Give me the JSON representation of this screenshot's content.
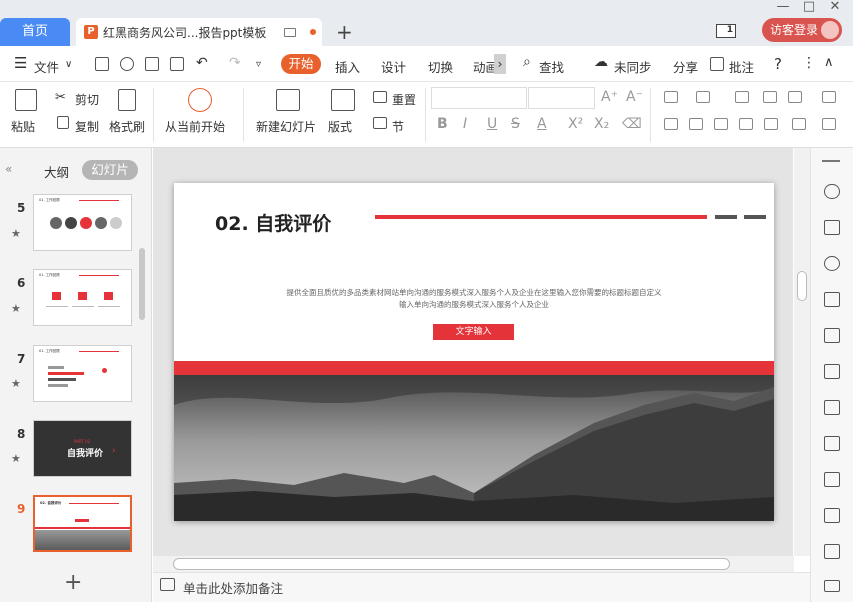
{
  "titlebar": {
    "home_tab": "首页",
    "doc_tab": "红黑商务风公司...报告ppt模板",
    "ppt_badge": "P",
    "new_tab": "+",
    "counter": "1",
    "visitor_login": "访客登录",
    "win_min": "—",
    "win_max": "□",
    "win_close": "✕"
  },
  "menu": {
    "file": "文件",
    "file_arrow": "∨",
    "start": "开始",
    "insert": "插入",
    "design": "设计",
    "switch": "切换",
    "animation": "动画",
    "more": "›",
    "search": "查找",
    "unsynced": "未同步",
    "share": "分享",
    "annotate": "批注",
    "help": "?",
    "more_dots": "⋮",
    "collapse": "∧"
  },
  "ribbon": {
    "paste": "粘贴",
    "cut": "剪切",
    "copy": "复制",
    "format_painter": "格式刷",
    "from_current": "从当前开始",
    "new_slide": "新建幻灯片",
    "layout": "版式",
    "reset": "重置",
    "section": "节",
    "bold": "B",
    "italic": "I",
    "underline": "U",
    "strike": "S",
    "font_color": "A",
    "superscript": "X²",
    "subscript": "X₂",
    "eraser": "⌫",
    "font_inc": "A⁺",
    "font_dec": "A⁻"
  },
  "left_panel": {
    "outline": "大纲",
    "slides": "幻灯片",
    "collapse": "«",
    "add": "+",
    "thumbnails": [
      {
        "num": "5",
        "star": "★",
        "label": "01. 工作回顾"
      },
      {
        "num": "6",
        "star": "★",
        "label": "01. 工作回顾"
      },
      {
        "num": "7",
        "star": "★",
        "label": "01. 工作回顾"
      },
      {
        "num": "8",
        "star": "★",
        "label": "自我评价",
        "sub": "PART 02"
      },
      {
        "num": "9",
        "star": "",
        "label": "02. 自我评价"
      }
    ]
  },
  "slide": {
    "title": "02. 自我评价",
    "desc_line1": "提供全面且质优的多品类素材网站单向沟通的服务模式深入服务个人及企业在这里输入您你需要的标题标题自定义",
    "desc_line2": "输入单向沟通的服务模式深入服务个人及企业",
    "button": "文字输入"
  },
  "notes": {
    "placeholder": "单击此处添加备注"
  },
  "colors": {
    "accent_orange": "#e8602c",
    "slide_red": "#e5333a",
    "home_blue": "#4a8af4",
    "login_red": "#d9534f"
  }
}
